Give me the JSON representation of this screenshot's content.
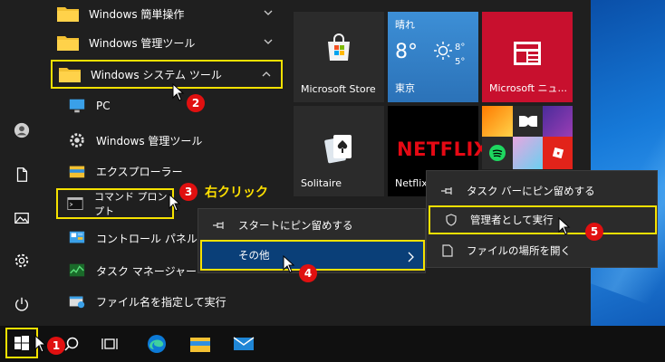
{
  "app_list": {
    "folders": [
      {
        "label": "Windows 簡単操作"
      },
      {
        "label": "Windows 管理ツール"
      },
      {
        "label": "Windows システム ツール"
      }
    ],
    "items": [
      {
        "label": "PC"
      },
      {
        "label": "Windows 管理ツール"
      },
      {
        "label": "エクスプローラー"
      },
      {
        "label": "コマンド プロンプト"
      },
      {
        "label": "コントロール パネル"
      },
      {
        "label": "タスク マネージャー"
      },
      {
        "label": "ファイル名を指定して実行"
      }
    ]
  },
  "tiles": {
    "store": {
      "label": "Microsoft Store"
    },
    "weather": {
      "condition": "晴れ",
      "temp": "8°",
      "high": "8°",
      "low": "5°",
      "city": "東京"
    },
    "news": {
      "label": "Microsoft ニュ..."
    },
    "solitaire": {
      "label": "Solitaire"
    },
    "netflix": {
      "logo": "NETFLIX",
      "label": "Netflix"
    }
  },
  "context_menu_1": {
    "pin_start": "スタートにピン留めする",
    "more": "その他"
  },
  "context_menu_2": {
    "pin_taskbar": "タスク バーにピン留めする",
    "run_admin": "管理者として実行",
    "open_location": "ファイルの場所を開く"
  },
  "annotations": {
    "step1": "1",
    "step2": "2",
    "step3": "3",
    "step4": "4",
    "step5": "5",
    "right_click": "右クリック"
  },
  "colors": {
    "highlight": "#f5e100",
    "badge": "#e01010",
    "accent": "#0063b1",
    "store_tile": "#2b2b2b",
    "weather_tile": "#2d7bc0",
    "news_tile": "#c8102e"
  }
}
